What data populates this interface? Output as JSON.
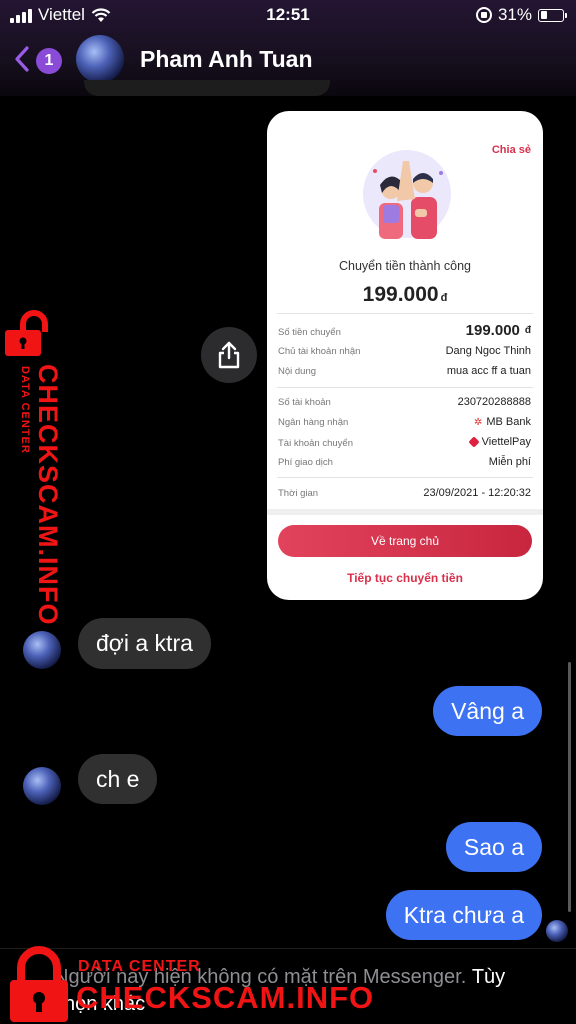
{
  "status_bar": {
    "carrier": "Viettel",
    "time": "12:51",
    "battery": "31%",
    "battery_level": 0.31
  },
  "nav": {
    "back_badge": "1",
    "contact_name": "Pham Anh Tuan"
  },
  "receipt": {
    "share": "Chia sẻ",
    "title": "Chuyển tiền thành công",
    "amount": "199.000",
    "currency": "đ",
    "rows_top": [
      {
        "label": "Số tiền chuyển",
        "value": "199.000",
        "currency": "đ"
      },
      {
        "label": "Chủ tài khoản nhận",
        "value": "Dang Ngoc Thinh"
      },
      {
        "label": "Nội dung",
        "value": "mua acc ff a tuan"
      }
    ],
    "rows_mid": [
      {
        "label": "Số tài khoản",
        "value": "230720288888"
      },
      {
        "label": "Ngân hàng nhận",
        "value": "MB Bank",
        "icon": "mb-bank-icon"
      },
      {
        "label": "Tài khoản chuyển",
        "value": "ViettelPay",
        "icon": "viettelpay-icon"
      },
      {
        "label": "Phí giao dịch",
        "value": "Miễn phí"
      }
    ],
    "row_time": {
      "label": "Thời gian",
      "value": "23/09/2021 - 12:20:32"
    },
    "home_button": "Về trang chủ",
    "continue_link": "Tiếp tục chuyển tiền"
  },
  "messages": [
    {
      "dir": "in",
      "text": "đợi a ktra"
    },
    {
      "dir": "out",
      "text": "Vâng a"
    },
    {
      "dir": "in",
      "text": "ch e"
    },
    {
      "dir": "out",
      "text": "Sao a"
    },
    {
      "dir": "out",
      "text": "Ktra chưa a"
    }
  ],
  "notice": {
    "text": "Người này hiện không có mặt trên Messenger.",
    "link": "Tùy chọn khác"
  },
  "watermark": {
    "brand": "CHECKSCAM.INFO",
    "sub": "DATA CENTER",
    "color": "#f01414"
  },
  "colors": {
    "outgoing_bubble": "#3d73f3",
    "incoming_bubble": "#303030",
    "accent_purple": "#8a4bd6",
    "receipt_red": "#d9304b"
  }
}
